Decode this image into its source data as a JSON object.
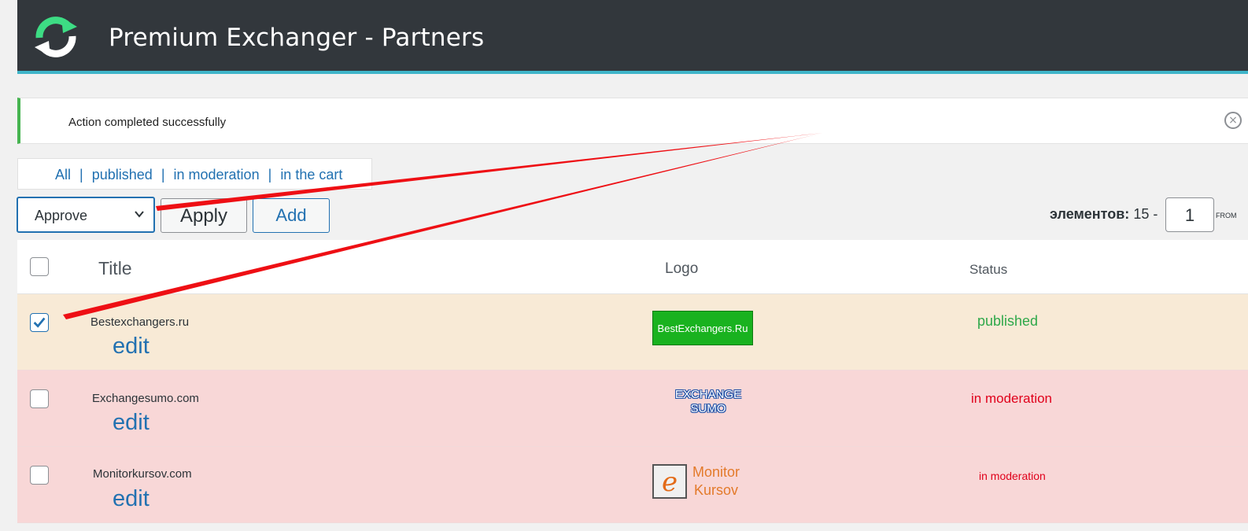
{
  "header": {
    "title": "Premium Exchanger - Partners",
    "logo_icon": "refresh-arrows-icon",
    "colors": {
      "bar": "#32373c",
      "accent": "#3fb5c9",
      "logo": "#3ddc84"
    }
  },
  "notice": {
    "message": "Action completed successfully",
    "close_symbol": "×",
    "color": "#46b450"
  },
  "subnav": {
    "links": [
      "All",
      "published",
      "in moderation",
      "in the cart"
    ],
    "separator": "|"
  },
  "bulk": {
    "selected": "Approve",
    "apply_label": "Apply",
    "add_label": "Add"
  },
  "pager": {
    "label": "элементов:",
    "count": "15 -",
    "page": "1",
    "from_label": "FROM"
  },
  "table": {
    "columns": {
      "title": "Title",
      "logo": "Logo",
      "status": "Status"
    },
    "rows": [
      {
        "title": "Bestexchangers.ru",
        "edit": "edit",
        "logo_text": "BestExchangers.Ru",
        "status": "published",
        "checked": true,
        "status_color": "#2ea84a"
      },
      {
        "title": "Exchangesumo.com",
        "edit": "edit",
        "logo_line1": "EXCHANGE",
        "logo_line2": "SUMO",
        "status": "in moderation",
        "checked": false,
        "status_color": "#e0001b"
      },
      {
        "title": "Monitorkursov.com",
        "edit": "edit",
        "logo_line1": "Monitor",
        "logo_line2": "Kursov",
        "status": "in moderation",
        "checked": false,
        "status_color": "#e0001b"
      }
    ]
  }
}
